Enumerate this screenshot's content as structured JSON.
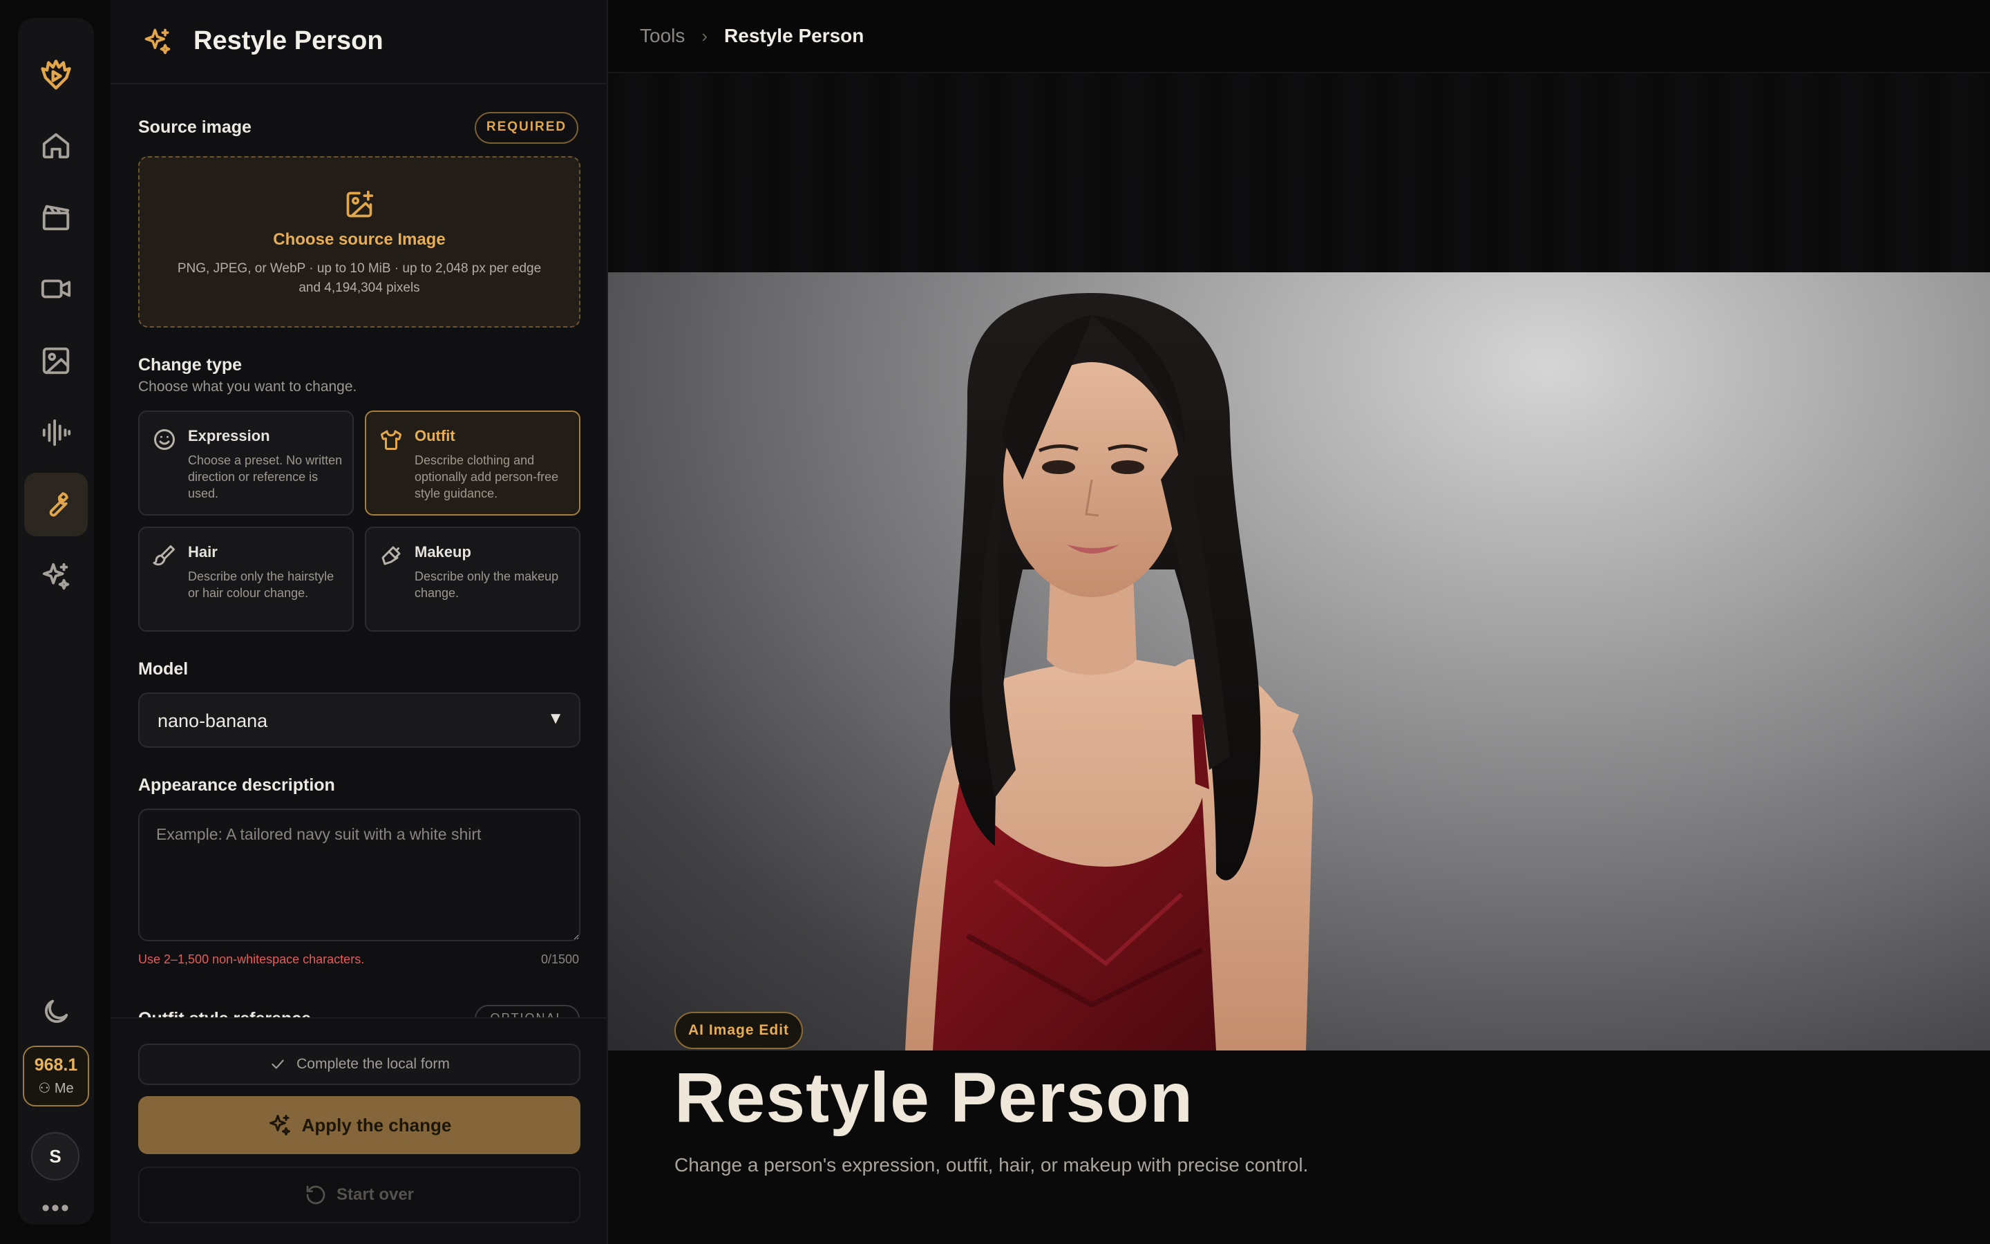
{
  "rail": {
    "credits": "968.1",
    "credits_owner": "Me",
    "avatar_initial": "S",
    "more": "•••",
    "icons": [
      "logo-icon",
      "home-icon",
      "clapperboard-icon",
      "video-icon",
      "image-icon",
      "audio-wave-icon",
      "wrench-icon",
      "sparkles-icon",
      "moon-icon"
    ]
  },
  "panel": {
    "title": "Restyle Person",
    "source": {
      "label": "Source image",
      "badge": "REQUIRED",
      "choose": "Choose source Image",
      "requirements": "PNG, JPEG, or WebP · up to 10 MiB · up to 2,048 px per edge and 4,194,304 pixels"
    },
    "change_type": {
      "label": "Change type",
      "hint": "Choose what you want to change.",
      "options": [
        {
          "title": "Expression",
          "desc": "Choose a preset. No written direction or reference is used.",
          "selected": false
        },
        {
          "title": "Outfit",
          "desc": "Describe clothing and optionally add person-free style guidance.",
          "selected": true
        },
        {
          "title": "Hair",
          "desc": "Describe only the hairstyle or hair colour change.",
          "selected": false
        },
        {
          "title": "Makeup",
          "desc": "Describe only the makeup change.",
          "selected": false
        }
      ]
    },
    "model": {
      "label": "Model",
      "value": "nano-banana"
    },
    "appearance": {
      "label": "Appearance description",
      "placeholder": "Example: A tailored navy suit with a white shirt",
      "error": "Use 2–1,500 non-whitespace characters.",
      "counter": "0/1500"
    },
    "outfit_reference": {
      "label": "Outfit style reference",
      "badge": "OPTIONAL"
    },
    "footer": {
      "local_form": "Complete the local form",
      "apply": "Apply the change",
      "reset": "Start over"
    }
  },
  "main": {
    "breadcrumb": {
      "parent": "Tools",
      "separator": "›",
      "current": "Restyle Person"
    },
    "tag": "AI Image Edit",
    "title": "Restyle Person",
    "description": "Change a person's expression, outfit, hair, or makeup with precise control."
  },
  "colors": {
    "accent": "#e2a64b",
    "apply_button": "#85663a",
    "error": "#e35d5d",
    "background": "#09090a"
  }
}
